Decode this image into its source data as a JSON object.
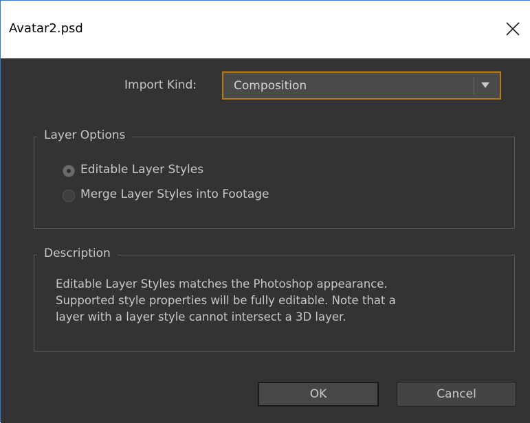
{
  "window": {
    "title": "Avatar2.psd",
    "close_icon": "close-icon"
  },
  "import_kind": {
    "label": "Import Kind:",
    "selected": "Composition",
    "accent_color": "#b57d14"
  },
  "layer_options": {
    "title": "Layer Options",
    "options": [
      {
        "label": "Editable Layer Styles",
        "selected": true
      },
      {
        "label": "Merge Layer Styles into Footage",
        "selected": false
      }
    ]
  },
  "description": {
    "title": "Description",
    "lines": [
      "Editable Layer Styles matches the Photoshop appearance.",
      "Supported style properties will be fully editable. Note that a",
      "layer with a layer style cannot intersect a 3D layer."
    ]
  },
  "buttons": {
    "ok": "OK",
    "cancel": "Cancel"
  }
}
